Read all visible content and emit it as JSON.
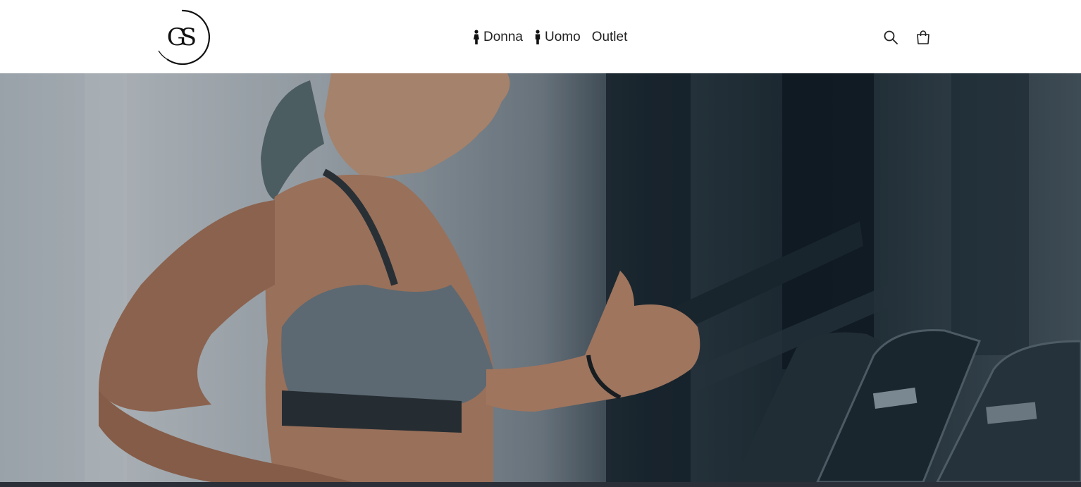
{
  "header": {
    "logo_text": "GS",
    "nav": [
      {
        "label": "Donna",
        "icon": "female-person-icon"
      },
      {
        "label": "Uomo",
        "icon": "male-person-icon"
      },
      {
        "label": "Outlet",
        "icon": ""
      }
    ],
    "actions": [
      {
        "icon": "search-icon"
      },
      {
        "icon": "cart-icon"
      }
    ]
  },
  "hero": {
    "image": "woman-running-on-treadmill-photo"
  },
  "colors": {
    "header_bg": "#ffffff",
    "text": "#222222",
    "bottom_bar": "#2b3038"
  }
}
